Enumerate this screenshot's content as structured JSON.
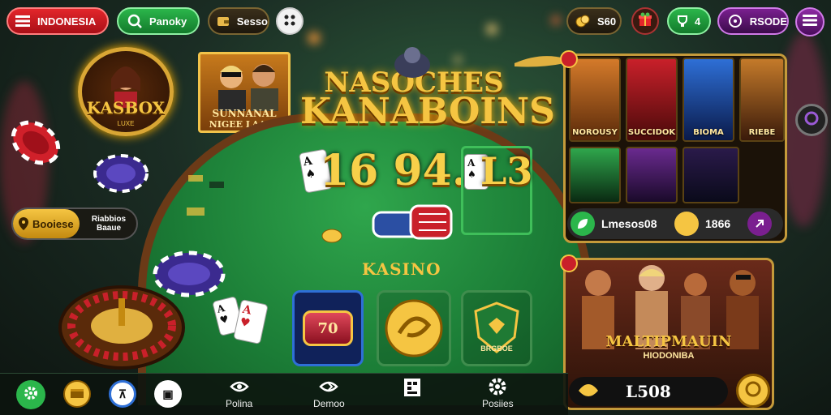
{
  "header": {
    "country_label": "INDONESIA",
    "account_label": "Panoky",
    "balance_label": "Sesso",
    "coins_label": "S60",
    "gift_label": "",
    "level_label": "4",
    "search_label": "RSODE"
  },
  "promos": {
    "kasbox_badge": "KASBOX",
    "kasbox_sub": "LUXE",
    "poster_title": "SUNNANAL",
    "poster_sub": "NIGEE LAARY"
  },
  "table": {
    "title_line1": "NASOCHES",
    "title_line2": "KANABOINS",
    "bet_number": "16 94.",
    "bet_number2": "L3",
    "table_label": "KASINO"
  },
  "side_chip": {
    "label": "Booiese",
    "value": "Riabbios Baaue"
  },
  "tiles": [
    {
      "label": "70"
    },
    {
      "label": ""
    },
    {
      "label": "BRGBOE"
    }
  ],
  "games_panel": {
    "thumbs": [
      {
        "label": "NOROUSY"
      },
      {
        "label": "SUCCIDOK"
      },
      {
        "label": "BIOMA"
      },
      {
        "label": "RIEBE"
      },
      {
        "label": ""
      },
      {
        "label": ""
      },
      {
        "label": ""
      }
    ],
    "footer_left": "Lmesos08",
    "footer_right": "1866"
  },
  "feature_panel": {
    "title": "MALTIPMAUIN",
    "subtitle": "HIODONIBA",
    "amount": "L508"
  },
  "bottom_nav": {
    "items": [
      {
        "label": "Polina"
      },
      {
        "label": "Demoo"
      },
      {
        "label": ""
      },
      {
        "label": "Posiies"
      }
    ]
  },
  "colors": {
    "gold": "#f5c542",
    "felt": "#1b7c36",
    "accent_red": "#e3262b",
    "accent_purple": "#7a1f8f"
  }
}
